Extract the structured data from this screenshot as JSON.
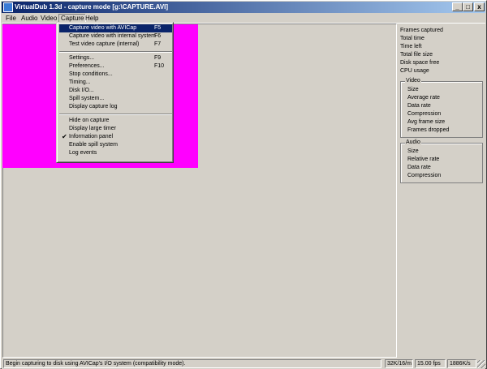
{
  "window": {
    "title": "VirtualDub 1.3d - capture mode [g:\\CAPTURE.AVI]",
    "min_glyph": "_",
    "max_glyph": "□",
    "close_glyph": "x"
  },
  "menubar": {
    "file": "File",
    "audio": "Audio",
    "video": "Video",
    "capture": "Capture",
    "help": "Help"
  },
  "capture_menu": {
    "items": [
      {
        "label": "Capture video with AVICap",
        "shortcut": "F5"
      },
      {
        "label": "Capture video with internal system",
        "shortcut": "F6"
      },
      {
        "label": "Test video capture (internal)",
        "shortcut": "F7"
      },
      {
        "label": "Settings...",
        "shortcut": "F9"
      },
      {
        "label": "Preferences...",
        "shortcut": "F10"
      },
      {
        "label": "Stop conditions...",
        "shortcut": ""
      },
      {
        "label": "Timing...",
        "shortcut": ""
      },
      {
        "label": "Disk I/O...",
        "shortcut": ""
      },
      {
        "label": "Spill system...",
        "shortcut": ""
      },
      {
        "label": "Display capture log",
        "shortcut": ""
      },
      {
        "label": "Hide on capture",
        "shortcut": ""
      },
      {
        "label": "Display large timer",
        "shortcut": ""
      },
      {
        "label": "Information panel",
        "shortcut": "",
        "checked": true
      },
      {
        "label": "Enable spill system",
        "shortcut": ""
      },
      {
        "label": "Log events",
        "shortcut": ""
      }
    ],
    "check_glyph": "✔"
  },
  "info_panel": {
    "general": [
      "Frames captured",
      "Total time",
      "Time left",
      "Total file size",
      "Disk space free",
      "CPU usage"
    ],
    "video": {
      "title": "Video",
      "items": [
        "Size",
        "Average rate",
        "Data rate",
        "Compression",
        "Avg frame size",
        "Frames dropped"
      ]
    },
    "audio": {
      "title": "Audio",
      "items": [
        "Size",
        "Relative rate",
        "Data rate",
        "Compression"
      ]
    }
  },
  "statusbar": {
    "message": "Begin capturing to disk using AVICap's I/O system (compatibility mode).",
    "disk": "32K/16/m",
    "fps": "15.00 fps",
    "rate": "1886K/s"
  },
  "colors": {
    "preview": "#ff00ff",
    "face": "#d4d0c8",
    "title_start": "#0a246a",
    "title_end": "#a6caf0",
    "highlight": "#0a246a"
  }
}
